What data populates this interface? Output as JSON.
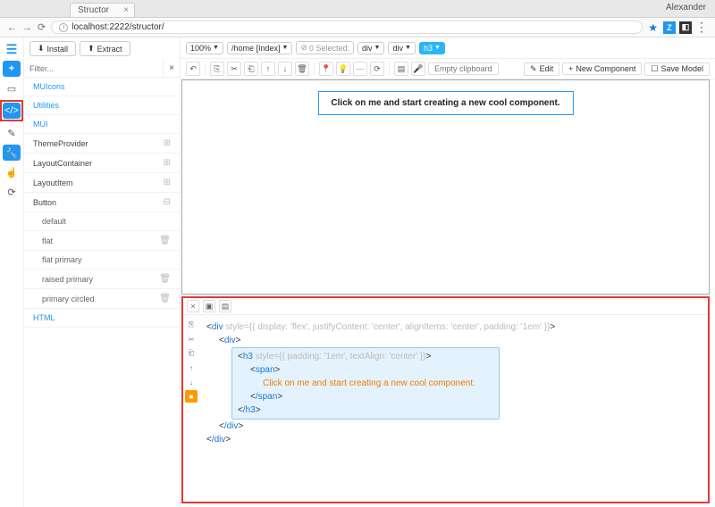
{
  "browser": {
    "user": "Alexander",
    "tab": "Structor",
    "url": "localhost:2222/structor/"
  },
  "rail": {
    "items": [
      "menu",
      "plus",
      "book",
      "code",
      "brush",
      "wrench",
      "hand",
      "refresh"
    ]
  },
  "sidebar": {
    "install": "Install",
    "extract": "Extract",
    "filter_placeholder": "Filter...",
    "items": [
      {
        "label": "MUIcons",
        "type": "link"
      },
      {
        "label": "Utilities",
        "type": "link"
      },
      {
        "label": "MUI",
        "type": "link"
      },
      {
        "label": "ThemeProvider",
        "type": "item",
        "expand": true
      },
      {
        "label": "LayoutContainer",
        "type": "item",
        "expand": true
      },
      {
        "label": "LayoutItem",
        "type": "item",
        "expand": true
      },
      {
        "label": "Button",
        "type": "item",
        "expand": true,
        "open": true
      },
      {
        "label": "default",
        "type": "sub"
      },
      {
        "label": "flat",
        "type": "sub",
        "del": true
      },
      {
        "label": "flat primary",
        "type": "sub"
      },
      {
        "label": "raised primary",
        "type": "sub",
        "del": true
      },
      {
        "label": "primary circled",
        "type": "sub",
        "del": true
      },
      {
        "label": "HTML",
        "type": "link"
      }
    ]
  },
  "topbar": {
    "zoom": "100%",
    "page": "/home [Index]",
    "selected": "0 Selected:",
    "crumbs": [
      "div",
      "div",
      "h3"
    ],
    "clipboard": "Empty clipboard",
    "edit": "Edit",
    "newcomp": "New Component",
    "save": "Save Model"
  },
  "canvas": {
    "text": "Click on me and start creating a new cool component."
  },
  "code": {
    "l1_tag": "div",
    "l1_attr": " style={{ display: 'flex', justifyContent: 'center', alignItems: 'center', padding: '1em' }}",
    "l2_tag": "div",
    "l3_tag": "h3",
    "l3_attr": " style={{ padding: '1em', textAlign: 'center' }}",
    "l4_tag": "span",
    "l5_text": "Click on me and start creating a new cool component.",
    "l6_tag": "/span",
    "l7_tag": "/h3",
    "l8_tag": "/div",
    "l9_tag": "/div"
  }
}
